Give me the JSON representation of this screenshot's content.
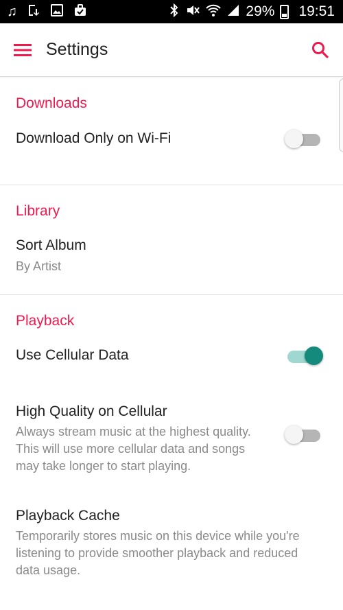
{
  "status_bar": {
    "battery_percent": "29%",
    "time": "19:51"
  },
  "app_bar": {
    "title": "Settings"
  },
  "sections": {
    "downloads": {
      "header": "Downloads",
      "wifi_only": {
        "title": "Download Only on Wi-Fi",
        "enabled": false
      }
    },
    "library": {
      "header": "Library",
      "sort_album": {
        "title": "Sort Album",
        "value": "By Artist"
      }
    },
    "playback": {
      "header": "Playback",
      "cellular_data": {
        "title": "Use Cellular Data",
        "enabled": true
      },
      "high_quality": {
        "title": "High Quality on Cellular",
        "description_line1": "Always stream music at the highest quality.",
        "description_line2": "This will use more cellular data and songs",
        "description_line3": "may take longer to start playing.",
        "enabled": false
      },
      "playback_cache": {
        "title": "Playback Cache",
        "description_line1": "Temporarily stores music on this device while you're",
        "description_line2": "listening to provide smoother playback and reduced",
        "description_line3": "data usage."
      }
    }
  },
  "colors": {
    "accent": "#f0194d",
    "switch_on": "#138a7c",
    "switch_on_track": "#9ed8d0",
    "switch_off_track": "#b5b5b5"
  },
  "icons": {
    "status_left": [
      "music-note-icon",
      "download-icon",
      "image-icon",
      "briefcase-icon"
    ],
    "status_right": [
      "bluetooth-icon",
      "mute-icon",
      "wifi-icon",
      "signal-icon",
      "battery-icon"
    ],
    "app_bar": [
      "menu-icon",
      "search-icon"
    ]
  }
}
